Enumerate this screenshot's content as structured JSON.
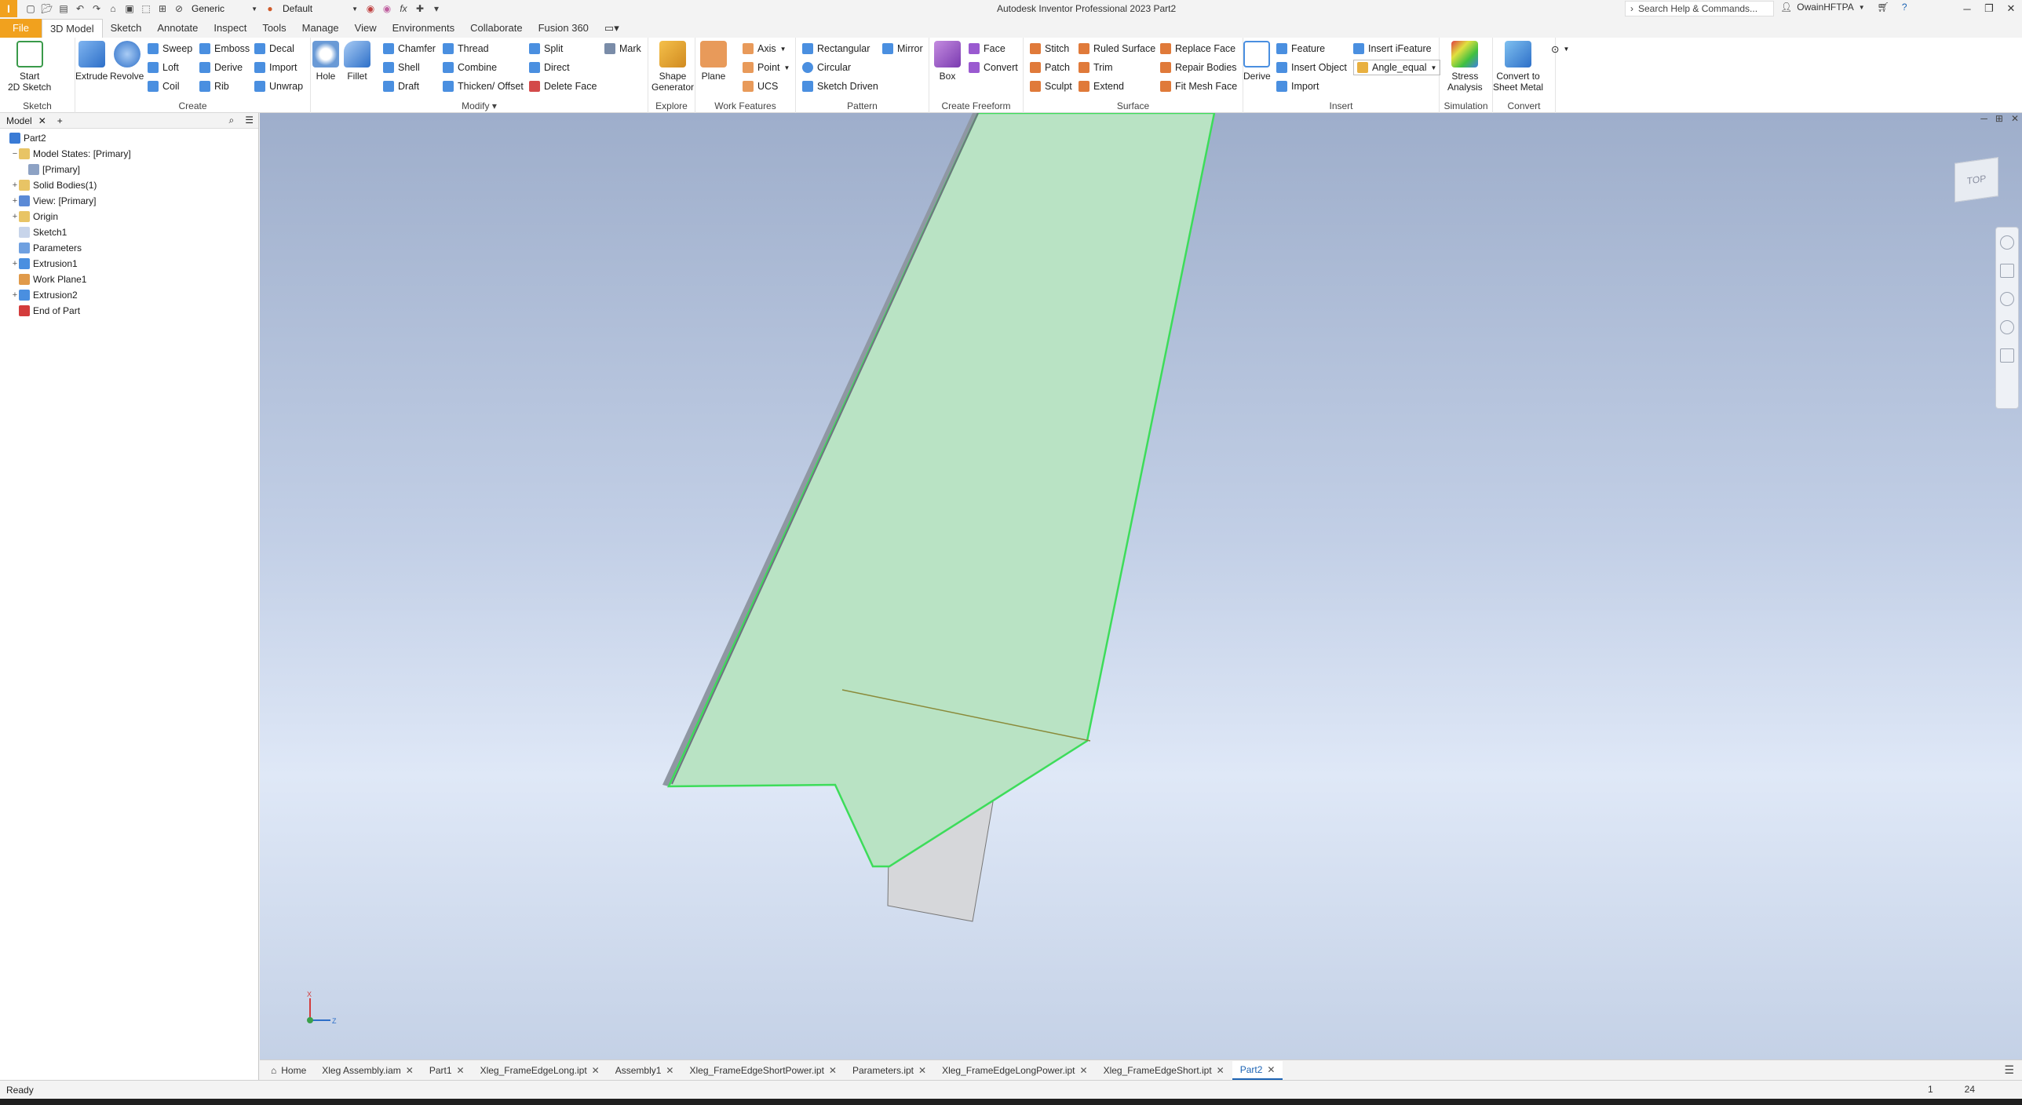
{
  "titlebar": {
    "logo_letter": "I",
    "material_select": "Generic",
    "appearance_select": "Default",
    "fx_label": "fx",
    "app_title": "Autodesk Inventor Professional 2023    Part2",
    "search_placeholder": "Search Help & Commands...",
    "user_name": "OwainHFTPA"
  },
  "ribbon_tabs": [
    "File",
    "3D Model",
    "Sketch",
    "Annotate",
    "Inspect",
    "Tools",
    "Manage",
    "View",
    "Environments",
    "Collaborate",
    "Fusion 360"
  ],
  "ribbon": {
    "sketch": {
      "label": "Sketch",
      "start_sketch": "Start\n2D Sketch"
    },
    "create": {
      "label": "Create",
      "extrude": "Extrude",
      "revolve": "Revolve",
      "sweep": "Sweep",
      "loft": "Loft",
      "coil": "Coil",
      "emboss": "Emboss",
      "derive": "Derive",
      "rib": "Rib",
      "decal": "Decal",
      "import": "Import",
      "unwrap": "Unwrap"
    },
    "modify": {
      "label": "Modify",
      "hole": "Hole",
      "fillet": "Fillet",
      "chamfer": "Chamfer",
      "shell": "Shell",
      "draft": "Draft",
      "thread": "Thread",
      "combine": "Combine",
      "thicken": "Thicken/ Offset",
      "split": "Split",
      "direct": "Direct",
      "delete_face": "Delete Face"
    },
    "explore": {
      "label": "Explore",
      "shape_generator": "Shape\nGenerator",
      "mark": "Mark"
    },
    "work_features": {
      "label": "Work Features",
      "plane": "Plane",
      "axis": "Axis",
      "point": "Point",
      "ucs": "UCS"
    },
    "pattern": {
      "label": "Pattern",
      "rectangular": "Rectangular",
      "circular": "Circular",
      "sketch_driven": "Sketch Driven",
      "mirror": "Mirror"
    },
    "freeform": {
      "label": "Create Freeform",
      "box": "Box",
      "face": "Face",
      "convert": "Convert"
    },
    "surface": {
      "label": "Surface",
      "stitch": "Stitch",
      "patch": "Patch",
      "sculpt": "Sculpt",
      "ruled_surface": "Ruled Surface",
      "trim": "Trim",
      "extend": "Extend",
      "replace_face": "Replace Face",
      "repair_bodies": "Repair Bodies",
      "fit_mesh_face": "Fit Mesh Face"
    },
    "insert": {
      "label": "Insert",
      "derive": "Derive",
      "feature": "Feature",
      "insert_object": "Insert Object",
      "import": "Import",
      "insert_ifeature": "Insert iFeature",
      "angle_equal": "Angle_equal"
    },
    "simulation": {
      "label": "Simulation",
      "stress": "Stress\nAnalysis"
    },
    "convert": {
      "label": "Convert",
      "sheet_metal": "Convert to\nSheet Metal"
    }
  },
  "browser": {
    "tab": "Model",
    "nodes": [
      {
        "label": "Part2",
        "indent": 0,
        "expander": "",
        "icon_color": "#3a7bd5"
      },
      {
        "label": "Model States: [Primary]",
        "indent": 1,
        "expander": "−",
        "icon_color": "#e8c465"
      },
      {
        "label": "[Primary]",
        "indent": 2,
        "expander": "",
        "icon_color": "#8da2c4"
      },
      {
        "label": "Solid Bodies(1)",
        "indent": 1,
        "expander": "+",
        "icon_color": "#e8c465"
      },
      {
        "label": "View: [Primary]",
        "indent": 1,
        "expander": "+",
        "icon_color": "#5b8ad6"
      },
      {
        "label": "Origin",
        "indent": 1,
        "expander": "+",
        "icon_color": "#e8c465"
      },
      {
        "label": "Sketch1",
        "indent": 1,
        "expander": "",
        "icon_color": "#c7d4ea"
      },
      {
        "label": "Parameters",
        "indent": 1,
        "expander": "",
        "icon_color": "#6fa0e0"
      },
      {
        "label": "Extrusion1",
        "indent": 1,
        "expander": "+",
        "icon_color": "#4a8fe0"
      },
      {
        "label": "Work Plane1",
        "indent": 1,
        "expander": "",
        "icon_color": "#e09a4a"
      },
      {
        "label": "Extrusion2",
        "indent": 1,
        "expander": "+",
        "icon_color": "#4a8fe0"
      },
      {
        "label": "End of Part",
        "indent": 1,
        "expander": "",
        "icon_color": "#d33c3c"
      }
    ]
  },
  "viewport": {
    "viewcube_label": "TOP",
    "triad_x": "X",
    "triad_z": "Z",
    "part_face_color": "#b6e0c0",
    "highlight_color": "#3ddc5a",
    "body_gray": "#d8d8d8"
  },
  "doc_tabs": [
    {
      "label": "Home",
      "closable": false,
      "active": false
    },
    {
      "label": "Xleg Assembly.iam",
      "closable": true,
      "active": false
    },
    {
      "label": "Part1",
      "closable": true,
      "active": false
    },
    {
      "label": "Xleg_FrameEdgeLong.ipt",
      "closable": true,
      "active": false
    },
    {
      "label": "Assembly1",
      "closable": true,
      "active": false
    },
    {
      "label": "Xleg_FrameEdgeShortPower.ipt",
      "closable": true,
      "active": false
    },
    {
      "label": "Parameters.ipt",
      "closable": true,
      "active": false
    },
    {
      "label": "Xleg_FrameEdgeLongPower.ipt",
      "closable": true,
      "active": false
    },
    {
      "label": "Xleg_FrameEdgeShort.ipt",
      "closable": true,
      "active": false
    },
    {
      "label": "Part2",
      "closable": true,
      "active": true
    }
  ],
  "status": {
    "text": "Ready",
    "count1": "1",
    "count2": "24"
  }
}
